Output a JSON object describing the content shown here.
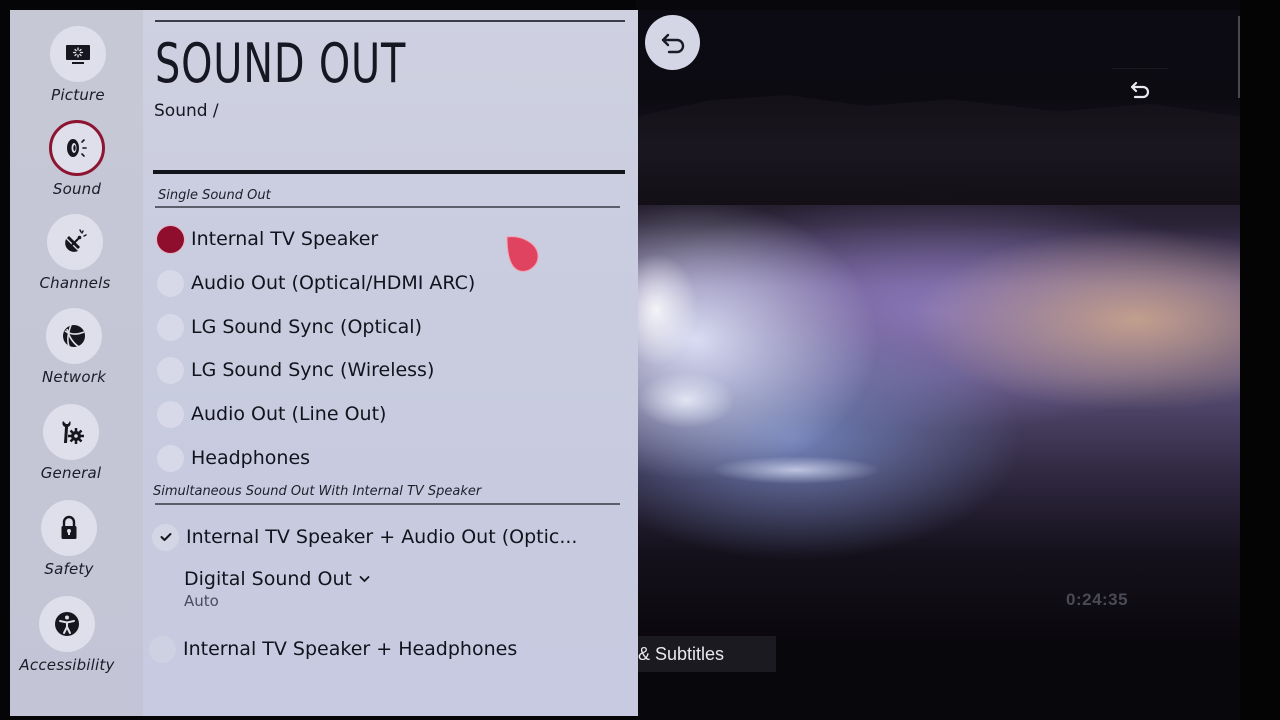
{
  "sidebar": {
    "items": [
      {
        "label": "Picture",
        "icon": "picture-icon",
        "active": false
      },
      {
        "label": "Sound",
        "icon": "sound-icon",
        "active": true
      },
      {
        "label": "Channels",
        "icon": "channels-satellite-icon",
        "active": false
      },
      {
        "label": "Network",
        "icon": "network-globe-icon",
        "active": false
      },
      {
        "label": "General",
        "icon": "general-wrench-gear-icon",
        "active": false
      },
      {
        "label": "Safety",
        "icon": "lock-icon",
        "active": false
      },
      {
        "label": "Accessibility",
        "icon": "accessibility-icon",
        "active": false
      }
    ]
  },
  "header": {
    "title": "SOUND OUT",
    "breadcrumb": "Sound /"
  },
  "single_section": {
    "label": "Single Sound Out",
    "options": [
      {
        "label": "Internal TV Speaker",
        "selected": true
      },
      {
        "label": "Audio Out (Optical/HDMI ARC)",
        "selected": false
      },
      {
        "label": "LG Sound Sync (Optical)",
        "selected": false
      },
      {
        "label": "LG Sound Sync (Wireless)",
        "selected": false
      },
      {
        "label": "Audio Out (Line Out)",
        "selected": false
      },
      {
        "label": "Headphones",
        "selected": false
      }
    ]
  },
  "simultaneous_section": {
    "label": "Simultaneous Sound Out With Internal TV Speaker",
    "options": [
      {
        "label": "Internal TV Speaker + Audio Out (Optic...",
        "checked": true
      },
      {
        "label": "Internal TV Speaker + Headphones",
        "checked": false
      }
    ],
    "digital_sound_out": {
      "label": "Digital Sound Out",
      "value": "Auto"
    }
  },
  "video": {
    "timestamp": "0:24:35",
    "subtitles_label": "& Subtitles"
  },
  "colors": {
    "accent": "#8f0e2e",
    "panel_bg": "#cfd1e1",
    "cursor": "#e0435f"
  }
}
